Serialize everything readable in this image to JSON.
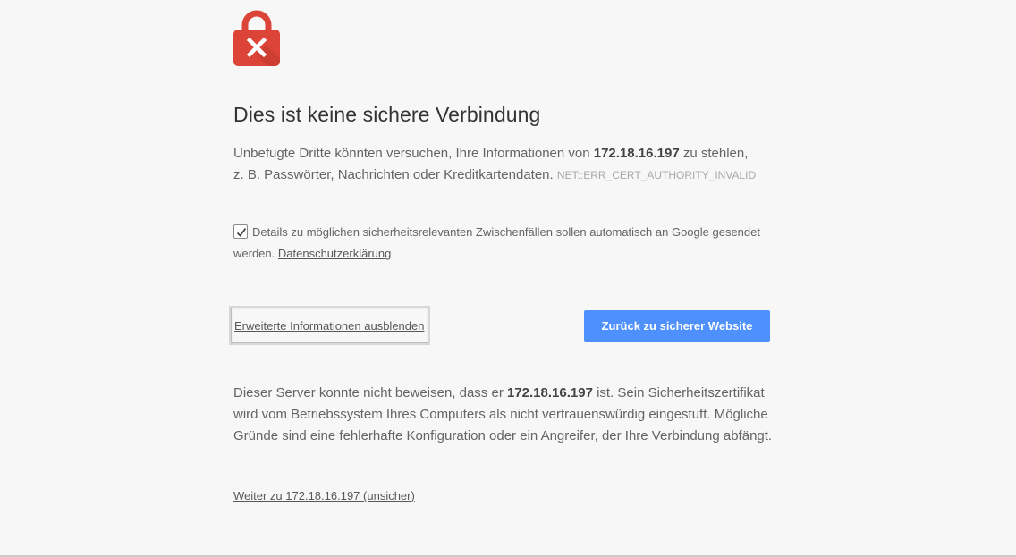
{
  "heading": "Dies ist keine sichere Verbindung",
  "description": {
    "part1": "Unbefugte Dritte könnten versuchen, Ihre Informationen von ",
    "host": "172.18.16.197",
    "part2": " zu stehlen,",
    "part3": "z. B. Passwörter, Nachrichten oder Kreditkartendaten. ",
    "error_code": "NET::ERR_CERT_AUTHORITY_INVALID"
  },
  "reporting": {
    "checked": true,
    "text": "Details zu möglichen sicherheitsrelevanten Zwischenfällen sollen automatisch an Google gesendet werden. ",
    "privacy_link": "Datenschutzerklärung"
  },
  "buttons": {
    "details_label": "Erweiterte Informationen ausblenden",
    "primary_label": "Zurück zu sicherer Website"
  },
  "details": {
    "part1": "Dieser Server konnte nicht beweisen, dass er ",
    "host": "172.18.16.197",
    "part2": " ist. Sein Sicherheitszertifikat wird vom Betriebssystem Ihres Computers als nicht vertrauenswürdig eingestuft. Mögliche Gründe sind eine fehlerhafte Konfiguration oder ein Angreifer, der Ihre Verbindung abfängt."
  },
  "proceed_link": "Weiter zu 172.18.16.197 (unsicher)",
  "colors": {
    "background": "#f7f7f7",
    "lock_red": "#db4437",
    "primary_blue": "#4d90fe"
  },
  "icons": {
    "lock": "lock-error-icon",
    "checkbox": "checkmark-icon"
  }
}
